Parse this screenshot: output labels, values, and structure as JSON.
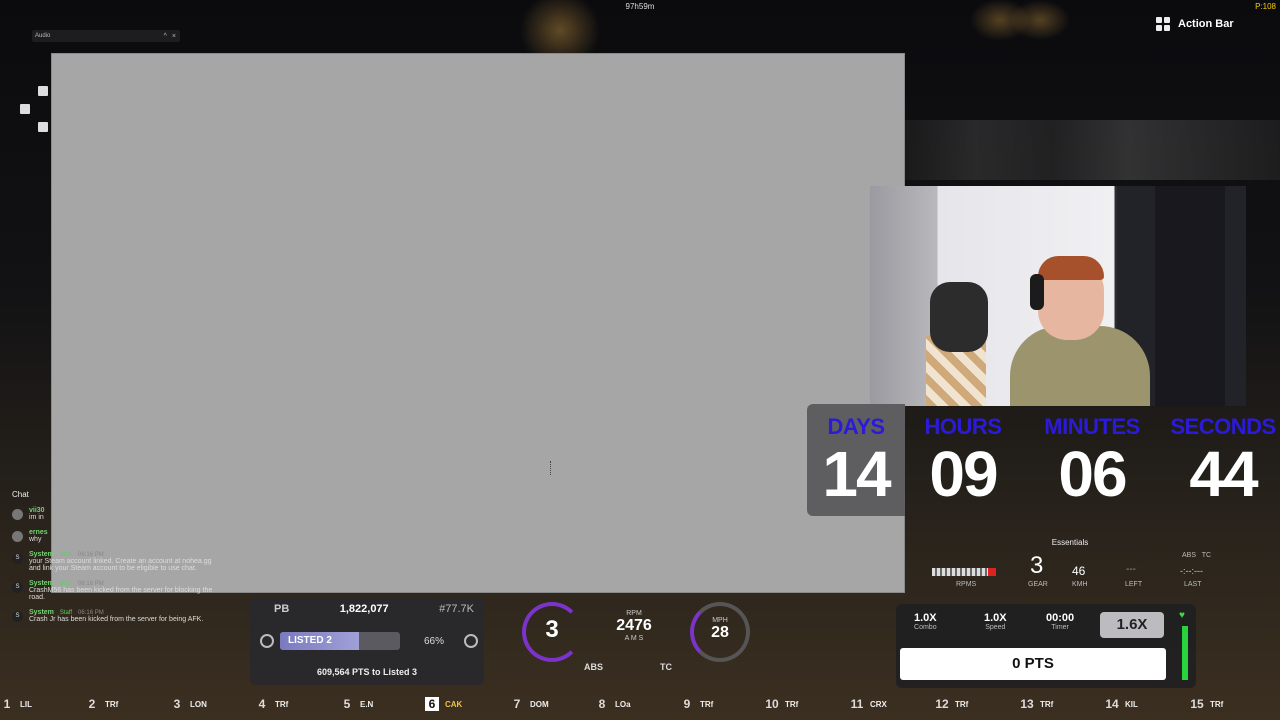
{
  "overlay": {
    "top_time": "97h59m",
    "ping": "P:108",
    "action_bar_label": "Action Bar",
    "audio_label": "Audio",
    "chat_label": "Chat"
  },
  "countdown": {
    "days_label": "DAYS",
    "days": "14",
    "hours_label": "HOURS",
    "hours": "09",
    "minutes_label": "MINUTES",
    "minutes": "06",
    "seconds_label": "SECONDS",
    "seconds": "44"
  },
  "essentials": {
    "title": "Essentials",
    "gear": "3",
    "kmh": "46",
    "left": "---",
    "abs_label": "ABS",
    "tc_label": "TC",
    "last": "-:--:---",
    "rpms_cap": "RPMS",
    "gear_cap": "GEAR",
    "kmh_cap": "KMH",
    "left_cap": "LEFT",
    "last_cap": "LAST"
  },
  "chat": {
    "messages": [
      {
        "user": "vii30",
        "text": "im in"
      },
      {
        "user": "ernes",
        "text": "why"
      },
      {
        "user": "System",
        "staff": "Staff",
        "time": "06:16 PM",
        "text": "your Steam account linked. Create an account at nohea.gg and link your Steam account to be eligible to use chat."
      },
      {
        "user": "System",
        "staff": "Staff",
        "time": "06:16 PM",
        "text": "CrashM56 has been kicked from the server for blocking the road."
      },
      {
        "user": "System",
        "staff": "Staff",
        "time": "06:16 PM",
        "text": "Crash Jr has been kicked from the server for being AFK."
      }
    ]
  },
  "pb": {
    "label": "PB",
    "score": "1,822,077",
    "rank": "#77.7K",
    "listed": "LISTED 2",
    "progress": 66,
    "percent_text": "66%",
    "to_next": "609,564 PTS to Listed 3"
  },
  "gauge": {
    "gear": "3",
    "rpm_label": "RPM",
    "rpm": "2476",
    "mode": "A M S",
    "mph_label": "MPH",
    "mph": "28",
    "abs": "ABS",
    "tc": "TC"
  },
  "combo": {
    "combo_v": "1.0X",
    "combo_l": "Combo",
    "speed_v": "1.0X",
    "speed_l": "Speed",
    "timer_v": "00:00",
    "timer_l": "Timer",
    "mult": "1.6X",
    "pts": "0 PTS"
  },
  "slots": [
    {
      "n": "1",
      "t": "LIL"
    },
    {
      "n": "2",
      "t": "TRf"
    },
    {
      "n": "3",
      "t": "LON"
    },
    {
      "n": "4",
      "t": "TRf"
    },
    {
      "n": "5",
      "t": "E.N"
    },
    {
      "n": "6",
      "t": "CAK"
    },
    {
      "n": "7",
      "t": "DOM"
    },
    {
      "n": "8",
      "t": "LOa"
    },
    {
      "n": "9",
      "t": "TRf"
    },
    {
      "n": "10",
      "t": "TRf"
    },
    {
      "n": "11",
      "t": "CRX"
    },
    {
      "n": "12",
      "t": "TRf"
    },
    {
      "n": "13",
      "t": "TRf"
    },
    {
      "n": "14",
      "t": "KIL"
    },
    {
      "n": "15",
      "t": "TRf"
    }
  ]
}
